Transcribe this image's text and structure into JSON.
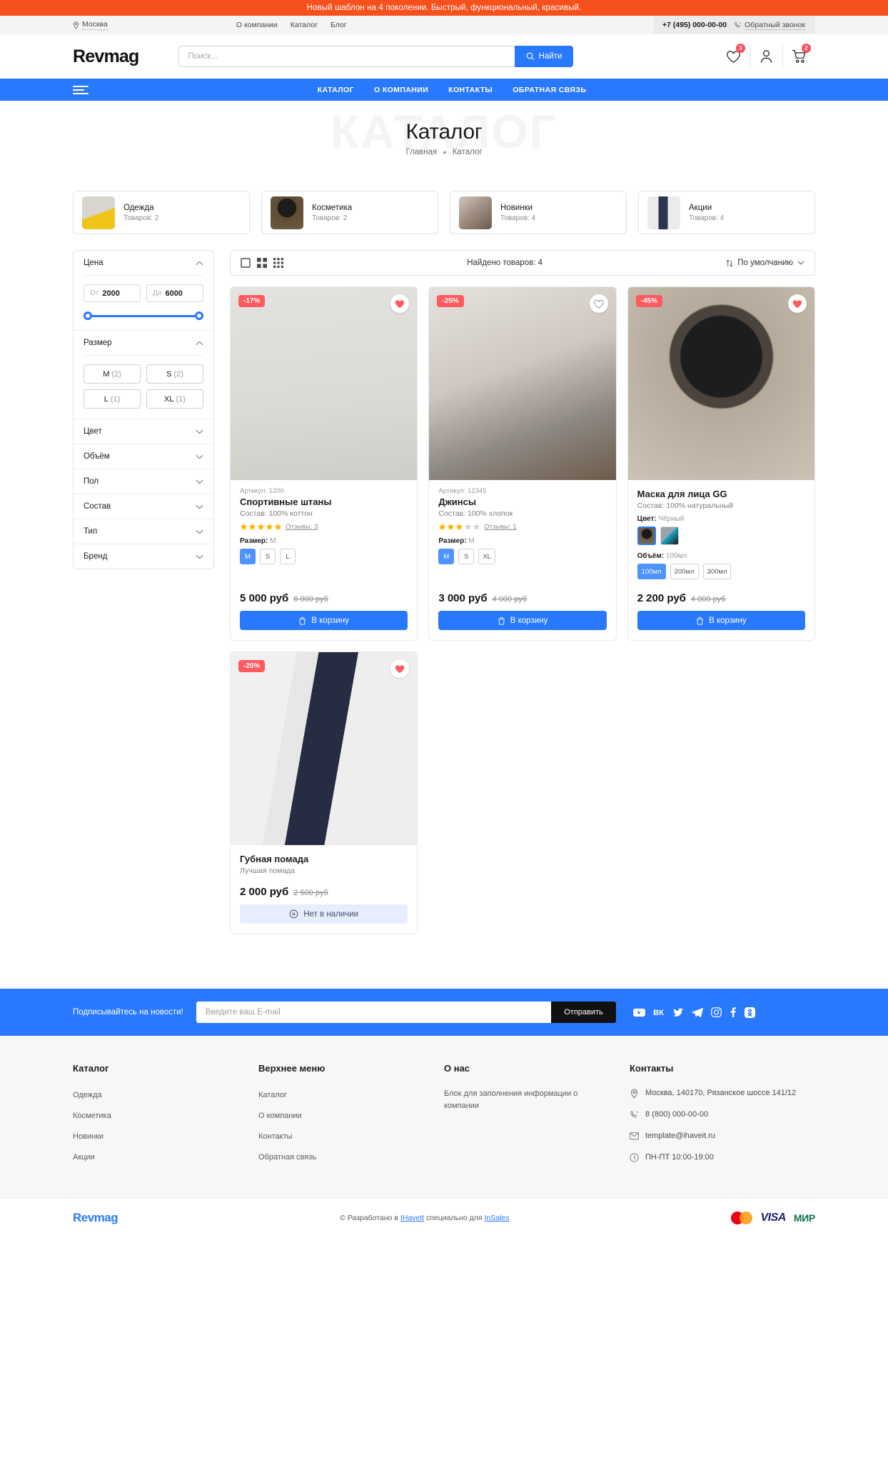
{
  "promo": {
    "text": "Новый шаблон на 4 поколении. Быстрый, функциональный, красивый."
  },
  "utilbar": {
    "city": "Москва",
    "links": [
      {
        "label": "О компании"
      },
      {
        "label": "Каталог"
      },
      {
        "label": "Блог"
      }
    ],
    "phone": "+7 (495) 000-00-00",
    "callback": "Обратный звонок"
  },
  "header": {
    "logo": "Revmag",
    "search_placeholder": "Поиск...",
    "search_value": "",
    "search_button": "Найти",
    "favorites_count": "3",
    "cart_count": "2"
  },
  "nav": {
    "items": [
      {
        "label": "КАТАЛОГ"
      },
      {
        "label": "О КОМПАНИИ"
      },
      {
        "label": "КОНТАКТЫ"
      },
      {
        "label": "ОБРАТНАЯ СВЯЗЬ"
      }
    ]
  },
  "hero": {
    "ghost": "КАТАЛОГ",
    "title": "Каталог",
    "breadcrumbs": [
      {
        "label": "Главная"
      },
      {
        "label": "Каталог"
      }
    ]
  },
  "categories": [
    {
      "name": "Одежда",
      "count": "Товаров: 2",
      "thumb_colors": [
        "#d8d5cf",
        "#f0c419"
      ]
    },
    {
      "name": "Косметика",
      "count": "Товаров: 2",
      "thumb_colors": [
        "#5f4c35",
        "#1c1c1c"
      ]
    },
    {
      "name": "Новинки",
      "count": "Товаров: 4",
      "thumb_colors": [
        "#cfc6bb",
        "#6b5a4c"
      ]
    },
    {
      "name": "Акции",
      "count": "Товаров: 4",
      "thumb_colors": [
        "#eceaea",
        "#2a3550"
      ]
    }
  ],
  "filters": {
    "price": {
      "title": "Цена",
      "from_prefix": "От",
      "from_value": "2000",
      "to_prefix": "До",
      "to_value": "6000"
    },
    "size": {
      "title": "Размер",
      "options": [
        {
          "label": "M",
          "count": "(2)"
        },
        {
          "label": "S",
          "count": "(2)"
        },
        {
          "label": "L",
          "count": "(1)"
        },
        {
          "label": "XL",
          "count": "(1)"
        }
      ]
    },
    "collapsed": [
      {
        "title": "Цвет"
      },
      {
        "title": "Объём"
      },
      {
        "title": "Пол"
      },
      {
        "title": "Состав"
      },
      {
        "title": "Тип"
      },
      {
        "title": "Бренд"
      }
    ]
  },
  "toolbar": {
    "found": "Найдено товаров: 4",
    "sort": "По умолчанию"
  },
  "products": [
    {
      "sku": "Артикул: 1200",
      "name": "Спортивные штаны",
      "desc": "Состав: 100% коттон",
      "discount": "-17%",
      "favorite": true,
      "rating": 5,
      "reviews": "Отзывы: 3",
      "option_label": "Размер:",
      "option_value": "M",
      "options": [
        {
          "label": "M",
          "selected": true
        },
        {
          "label": "S",
          "selected": false
        },
        {
          "label": "L",
          "selected": false
        }
      ],
      "price": "5 000 руб",
      "old_price": "6 000 руб",
      "button": "В корзину",
      "in_stock": true,
      "img_colors": [
        "#dcdcd8",
        "#c9c7c1"
      ]
    },
    {
      "sku": "Артикул: 12345",
      "name": "Джинсы",
      "desc": "Состав: 100% хлопок",
      "discount": "-25%",
      "favorite": false,
      "rating": 3,
      "reviews": "Отзывы: 1",
      "option_label": "Размер:",
      "option_value": "M",
      "options": [
        {
          "label": "M",
          "selected": true
        },
        {
          "label": "S",
          "selected": false
        },
        {
          "label": "XL",
          "selected": false
        }
      ],
      "price": "3 000 руб",
      "old_price": "4 000 руб",
      "button": "В корзину",
      "in_stock": true,
      "img_colors": [
        "#d3cdc7",
        "#8a8480"
      ]
    },
    {
      "sku": "",
      "name": "Маска для лица GG",
      "desc": "Состав: 100% натуральный",
      "discount": "-45%",
      "favorite": true,
      "rating": 0,
      "reviews": "",
      "color_label": "Цвет:",
      "color_value": "Чёрный",
      "swatches": [
        {
          "selected": true,
          "colors": [
            "#6b5a45",
            "#1a1a1a"
          ]
        },
        {
          "selected": false,
          "colors": [
            "#9aa3ab",
            "#17a9c8"
          ]
        }
      ],
      "option_label": "Объём:",
      "option_value": "100мл",
      "options": [
        {
          "label": "100мл",
          "selected": true
        },
        {
          "label": "200мл",
          "selected": false
        },
        {
          "label": "300мл",
          "selected": false
        }
      ],
      "price": "2 200 руб",
      "old_price": "4 000 руб",
      "button": "В корзину",
      "in_stock": true,
      "img_colors": [
        "#b8aea2",
        "#3a3530"
      ]
    },
    {
      "sku": "",
      "name": "Губная помада",
      "desc": "Лучшая помада",
      "discount": "-20%",
      "favorite": true,
      "rating": 0,
      "reviews": "",
      "options": [],
      "price": "2 000 руб",
      "old_price": "2 500 руб",
      "button": "Нет в наличии",
      "in_stock": false,
      "img_colors": [
        "#ececec",
        "#22283c"
      ]
    }
  ],
  "subscribe": {
    "title": "Подписывайтесь на новости!",
    "placeholder": "Введите ваш E-mail",
    "value": "",
    "button": "Отправить",
    "socials": [
      {
        "name": "youtube-icon"
      },
      {
        "name": "vk-icon"
      },
      {
        "name": "twitter-icon"
      },
      {
        "name": "telegram-icon"
      },
      {
        "name": "instagram-icon"
      },
      {
        "name": "facebook-icon"
      },
      {
        "name": "odnoklassniki-icon"
      }
    ]
  },
  "footer": {
    "catalog": {
      "title": "Каталог",
      "items": [
        {
          "label": "Одежда"
        },
        {
          "label": "Косметика"
        },
        {
          "label": "Новинки"
        },
        {
          "label": "Акции"
        }
      ]
    },
    "topmenu": {
      "title": "Верхнее меню",
      "items": [
        {
          "label": "Каталог"
        },
        {
          "label": "О компании"
        },
        {
          "label": "Контакты"
        },
        {
          "label": "Обратная связь"
        }
      ]
    },
    "about": {
      "title": "О нас",
      "text": "Блок для заполнения информации о компании"
    },
    "contacts": {
      "title": "Контакты",
      "address": "Москва, 140170, Рязанское шоссе 141/12",
      "phone": "8 (800) 000-00-00",
      "email": "template@ihaveit.ru",
      "hours": "ПН-ПТ 10:00-19:00"
    }
  },
  "bottom": {
    "logo": "Revmag",
    "copy_prefix": "© Разработано в ",
    "copy_link1": "IHaveIt",
    "copy_mid": " специально для ",
    "copy_link2": "InSales",
    "payments": [
      {
        "name": "mastercard-icon"
      },
      {
        "name": "visa-icon",
        "label": "VISA"
      },
      {
        "name": "mir-icon",
        "label": "МИР"
      }
    ]
  },
  "colors": {
    "accent": "#2979ff",
    "promo": "#f6511d",
    "danger": "#ff5a5f",
    "star": "#ffb400"
  }
}
